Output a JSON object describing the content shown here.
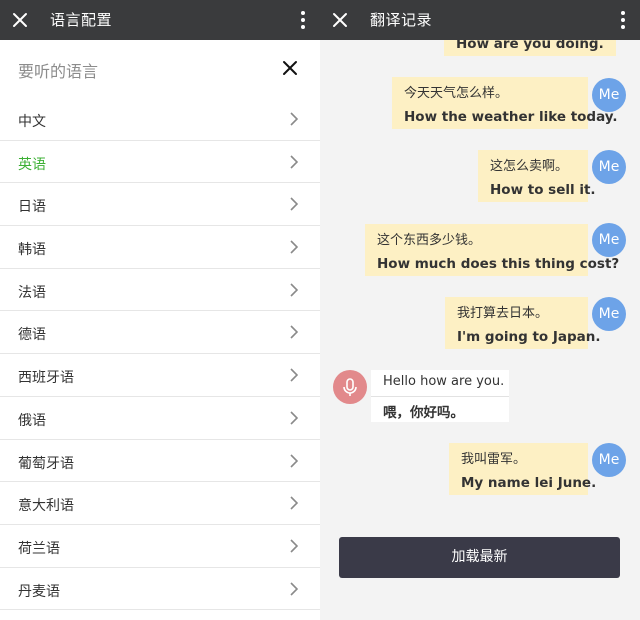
{
  "left_panel": {
    "title": "语言配置",
    "sheet_title": "要听的语言",
    "languages": [
      {
        "label": "中文",
        "selected": false
      },
      {
        "label": "英语",
        "selected": true
      },
      {
        "label": "日语",
        "selected": false
      },
      {
        "label": "韩语",
        "selected": false
      },
      {
        "label": "法语",
        "selected": false
      },
      {
        "label": "德语",
        "selected": false
      },
      {
        "label": "西班牙语",
        "selected": false
      },
      {
        "label": "俄语",
        "selected": false
      },
      {
        "label": "葡萄牙语",
        "selected": false
      },
      {
        "label": "意大利语",
        "selected": false
      },
      {
        "label": "荷兰语",
        "selected": false
      },
      {
        "label": "丹麦语",
        "selected": false
      }
    ]
  },
  "right_panel": {
    "title": "翻译记录",
    "partial_message": "How are you doing.",
    "messages": [
      {
        "from": "me",
        "source": "今天天气怎么样。",
        "translation": "How the weather like today."
      },
      {
        "from": "me",
        "source": "这怎么卖啊。",
        "translation": "How to sell it."
      },
      {
        "from": "me",
        "source": "这个东西多少钱。",
        "translation": "How much does this thing cost?"
      },
      {
        "from": "me",
        "source": "我打算去日本。",
        "translation": "I'm going to Japan."
      },
      {
        "from": "other",
        "source": "Hello how are you.",
        "translation": "喂，你好吗。"
      },
      {
        "from": "me",
        "source": "我叫雷军。",
        "translation": "My name lei June."
      }
    ],
    "avatar_label": "Me",
    "load_button": "加载最新"
  },
  "icons": {
    "close": "close-icon",
    "more": "more-vertical-icon",
    "chevron": "chevron-right-icon",
    "mic": "microphone-icon"
  },
  "colors": {
    "appbar": "#3a3b3d",
    "selected_language": "#3cb034",
    "my_bubble": "#fdf0c4",
    "other_bubble": "#ffffff",
    "avatar": "#6da3e8",
    "mic_avatar": "#e2898b",
    "load_button": "#3a3a48"
  }
}
